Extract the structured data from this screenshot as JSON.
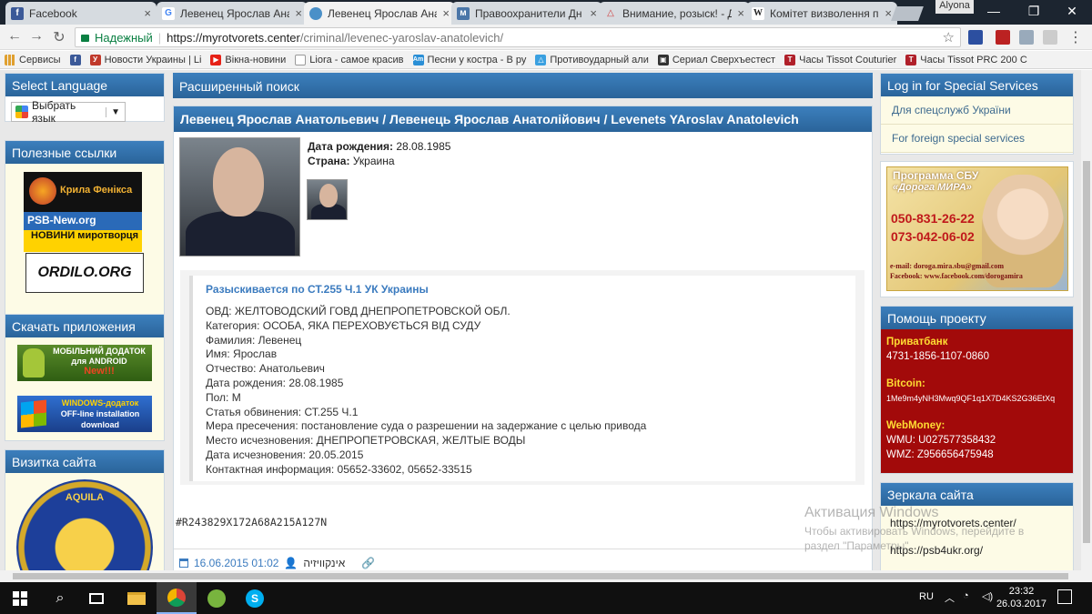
{
  "browser": {
    "tabs": [
      {
        "title": "Facebook",
        "icon": "facebook-icon",
        "color": "#3b5998",
        "glyph": "f"
      },
      {
        "title": "Левенец Ярослав Ана",
        "icon": "google-icon",
        "color": "#ffffff",
        "glyph": "G"
      },
      {
        "title": "Левенец Ярослав Ана",
        "icon": "globe-icon",
        "color": "#4a90c8",
        "glyph": ""
      },
      {
        "title": "Правоохранители Дн",
        "icon": "vk-icon",
        "color": "#4a76a8",
        "glyph": "м"
      },
      {
        "title": "Внимание, розыск! - Д",
        "icon": "warning-icon",
        "color": "#d04040",
        "glyph": "!"
      },
      {
        "title": "Комітет визволення п",
        "icon": "wikipedia-icon",
        "color": "#ffffff",
        "glyph": "W"
      }
    ],
    "active_tab": 2,
    "profile": "Alyona",
    "omnibox": {
      "secure_label": "Надежный",
      "url_host": "https://myrotvorets.center",
      "url_path": "/criminal/levenec-yaroslav-anatolevich/"
    },
    "bookmarks": [
      {
        "label": "Сервисы",
        "icon": "apps-icon",
        "color": "#e0a030",
        "glyph": ""
      },
      {
        "label": "",
        "icon": "facebook-icon",
        "color": "#3b5998",
        "glyph": "f"
      },
      {
        "label": "Новости Украины | Li",
        "icon": "ukrinform-icon",
        "color": "#c0392b",
        "glyph": "У"
      },
      {
        "label": "Вікна-новини",
        "icon": "youtube-icon",
        "color": "#e62117",
        "glyph": "▶"
      },
      {
        "label": "Liora - самое красив",
        "icon": "page-icon",
        "color": "#9a9a9a",
        "glyph": ""
      },
      {
        "label": "Песни у костра - В ру",
        "icon": "am-icon",
        "color": "#2a8fd6",
        "glyph": "Am"
      },
      {
        "label": "Противоударный али",
        "icon": "shop-icon",
        "color": "#3aa0e0",
        "glyph": "△"
      },
      {
        "label": "Сериал Сверхъестест",
        "icon": "tv-icon",
        "color": "#333333",
        "glyph": "▣"
      },
      {
        "label": "Часы Tissot Couturier",
        "icon": "tissot-icon",
        "color": "#b0202a",
        "glyph": "T"
      },
      {
        "label": "Часы Tissot PRC 200 C",
        "icon": "tissot-icon",
        "color": "#b0202a",
        "glyph": "T"
      }
    ]
  },
  "left_sidebar": {
    "language": {
      "heading": "Select Language",
      "select_label": "Выбрать язык"
    },
    "links": {
      "heading": "Полезные ссылки",
      "banners": [
        "Крила Фенікса",
        "PSB-New.org",
        "НОВИНИ миротворця",
        "ORDILO.ORG"
      ]
    },
    "apps": {
      "heading": "Скачать приложения",
      "android": [
        "МОБІЛЬНИЙ ДОДАТОК",
        "для ANDROID",
        "New!!!"
      ],
      "windows": [
        "WINDOWS-додаток",
        "OFF-line installation",
        "download"
      ]
    },
    "card": {
      "heading": "Визитка сайта",
      "emblem_text": "AQUILA"
    }
  },
  "main": {
    "search_heading": "Расширенный поиск",
    "person_title": "Левенец Ярослав Анатольевич / Левенець Ярослав Анатолійович / Levenets YAroslav Anatolevich",
    "birth_label": "Дата рождения:",
    "birth_value": "28.08.1985",
    "country_label": "Страна:",
    "country_value": "Украина",
    "wanted": {
      "title": "Разыскивается по СТ.255 Ч.1 УК Украины",
      "lines": [
        "ОВД: ЖЕЛТОВОДСКИЙ ГОВД ДНЕПРОПЕТРОВСКОЙ ОБЛ.",
        "Категория: ОСОБА, ЯКА ПЕРЕХОВУЄТЬСЯ ВІД СУДУ",
        "Фамилия: Левенец",
        "Имя: Ярослав",
        "Отчество: Анатольевич",
        "Дата рождения: 28.08.1985",
        "Пол: М",
        "Статья обвинения: СТ.255 Ч.1",
        "Мера пресечения: постановление суда о разрешении на задержание с целью привода",
        "Место исчезновения: ДНЕПРОПЕТРОВСКАЯ, ЖЕЛТЫЕ ВОДЫ",
        "Дата исчезновения: 20.05.2015",
        "Контактная информация: 05652-33602, 05652-33515"
      ]
    },
    "record_code": "#R243829X172A68A215A127N",
    "footer": {
      "date": "16.06.2015 01:02",
      "author": "אינקוויזיה"
    }
  },
  "right_sidebar": {
    "login": {
      "heading": "Log in for Special Services",
      "links": [
        "Для спецслужб України",
        "For foreign special services"
      ]
    },
    "sbu_banner": {
      "title1": "Программа СБУ",
      "title2": "«Дорога МИРА»",
      "phone1": "050-831-26-22",
      "phone2": "073-042-06-02",
      "email": "e-mail: doroga.mira.sbu@gmail.com",
      "facebook": "Facebook: www.facebook.com/dorogamira"
    },
    "help": {
      "heading": "Помощь проекту",
      "privat_label": "Приватбанк",
      "privat_value": "4731-1856-1107-0860",
      "bitcoin_label": "Bitcoin:",
      "bitcoin_value": "1Me9m4yNH3Mwq9QF1q1X7D4KS2G36EtXq",
      "webmoney_label": "WebMoney:",
      "wmu": "WMU: U027577358432",
      "wmz": "WMZ: Z956656475948"
    },
    "mirrors": {
      "heading": "Зеркала сайта",
      "links": [
        "https://myrotvorets.center/",
        "https://psb4ukr.org/"
      ]
    }
  },
  "watermark": {
    "line1": "Активация Windows",
    "line2": "Чтобы активировать Windows, перейдите в",
    "line3": "раздел \"Параметры\"."
  },
  "taskbar": {
    "lang": "RU",
    "time": "23:32",
    "date": "26.03.2017",
    "apps": [
      "windows-start-icon",
      "search-icon",
      "task-view-icon",
      "file-explorer-icon",
      "chrome-icon",
      "utorrent-icon",
      "skype-icon"
    ]
  }
}
